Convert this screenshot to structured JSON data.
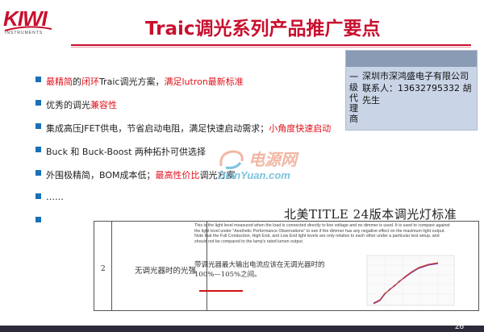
{
  "logo": {
    "text": "KIWI",
    "subtext": "INSTRUMENTS"
  },
  "title": "Traic调光系列产品推广要点",
  "bullets": [
    {
      "parts": [
        {
          "t": "最精简",
          "red": true
        },
        {
          "t": "的",
          "red": false
        },
        {
          "t": "闭环",
          "red": true
        },
        {
          "t": "Traic调光方案，",
          "red": false
        },
        {
          "t": "满足lutron最新标准",
          "red": true
        }
      ]
    },
    {
      "parts": [
        {
          "t": "优秀的调光",
          "red": false
        },
        {
          "t": "兼容性",
          "red": true
        }
      ]
    },
    {
      "parts": [
        {
          "t": "集成高压JFET供电，节省启动电阻，满足快速启动需求；",
          "red": false
        },
        {
          "t": "小角度快速启动",
          "red": true
        }
      ]
    },
    {
      "parts": [
        {
          "t": "Buck 和 Buck-Boost 两种拓扑可供选择",
          "red": false
        }
      ]
    },
    {
      "parts": [
        {
          "t": "外围极精简，BOM成本低；",
          "red": false
        },
        {
          "t": "最高性价比",
          "red": true
        },
        {
          "t": "调光方案",
          "red": false
        }
      ]
    },
    {
      "parts": [
        {
          "t": "……",
          "red": false
        }
      ]
    },
    {
      "parts": [
        {
          "t": "",
          "red": false
        }
      ]
    }
  ],
  "contact": {
    "tag": "一级代理商",
    "company": "深圳市深鸿盛电子有限公司",
    "person": "联系人：13632795332 胡先生"
  },
  "watermark": {
    "top": "电源网",
    "bottom": "DianYuan.com"
  },
  "standard_title": "北美TITLE 24版本调光灯标准",
  "table": {
    "num": "2",
    "name": "无调光器时的光强",
    "english": "This is the light level measured when the load is connected directly to line voltage and no dimmer is used. It is used to compare against the light level under \"Aesthetic Performance Observations\" to see if the dimmer has any negative effect on the maximum light output. Note that the Full Conduction, High End, and Low End light levels are only relative to each other under a particular test setup, and should not be compared to the lamp's rated lumen output.",
    "chinese": "带调光器最大输出电流应该在无调光器时的100%—105%之间。"
  },
  "page_number": "26",
  "colors": {
    "accent": "#c8102e",
    "bullet": "#1a6fb5",
    "contact_bg": "#c9d4e6"
  }
}
